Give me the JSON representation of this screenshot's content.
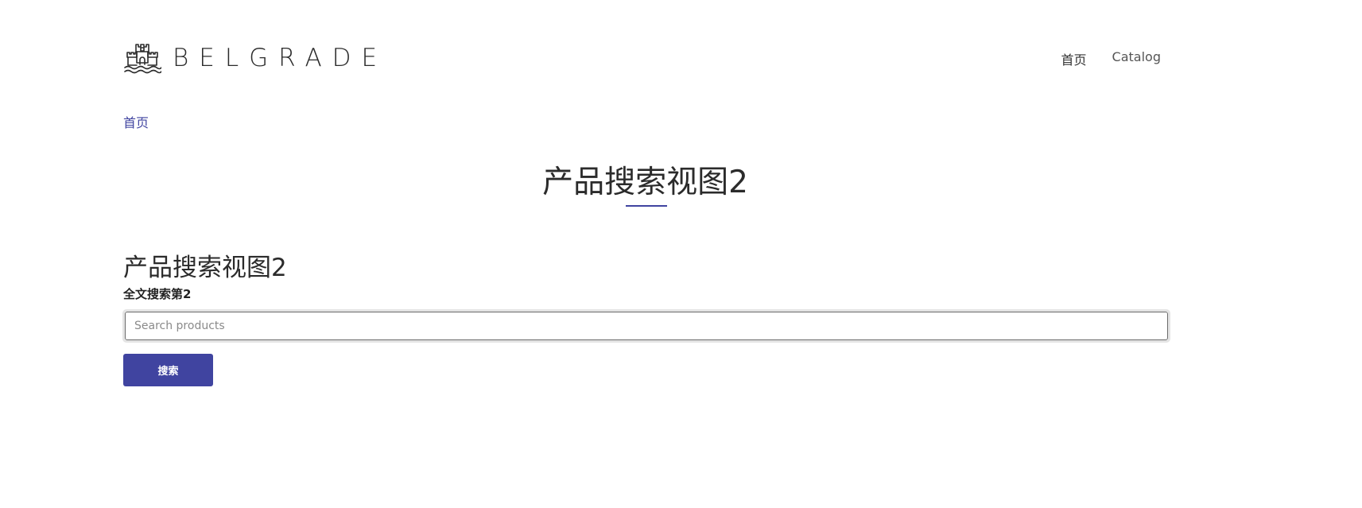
{
  "header": {
    "logo_text": "BELGRADE",
    "nav": [
      {
        "label": "首页"
      },
      {
        "label": "Catalog"
      }
    ]
  },
  "breadcrumb": {
    "home": "首页"
  },
  "page": {
    "title": "产品搜索视图2",
    "section_title": "产品搜索视图2",
    "field_label": "全文搜索第2"
  },
  "search": {
    "value": "",
    "placeholder": "Search products",
    "button_label": "搜索"
  },
  "colors": {
    "accent": "#4044a0",
    "text": "#2b2b2b",
    "nav_text": "#555555"
  },
  "icons": {
    "logo": "castle-icon"
  }
}
